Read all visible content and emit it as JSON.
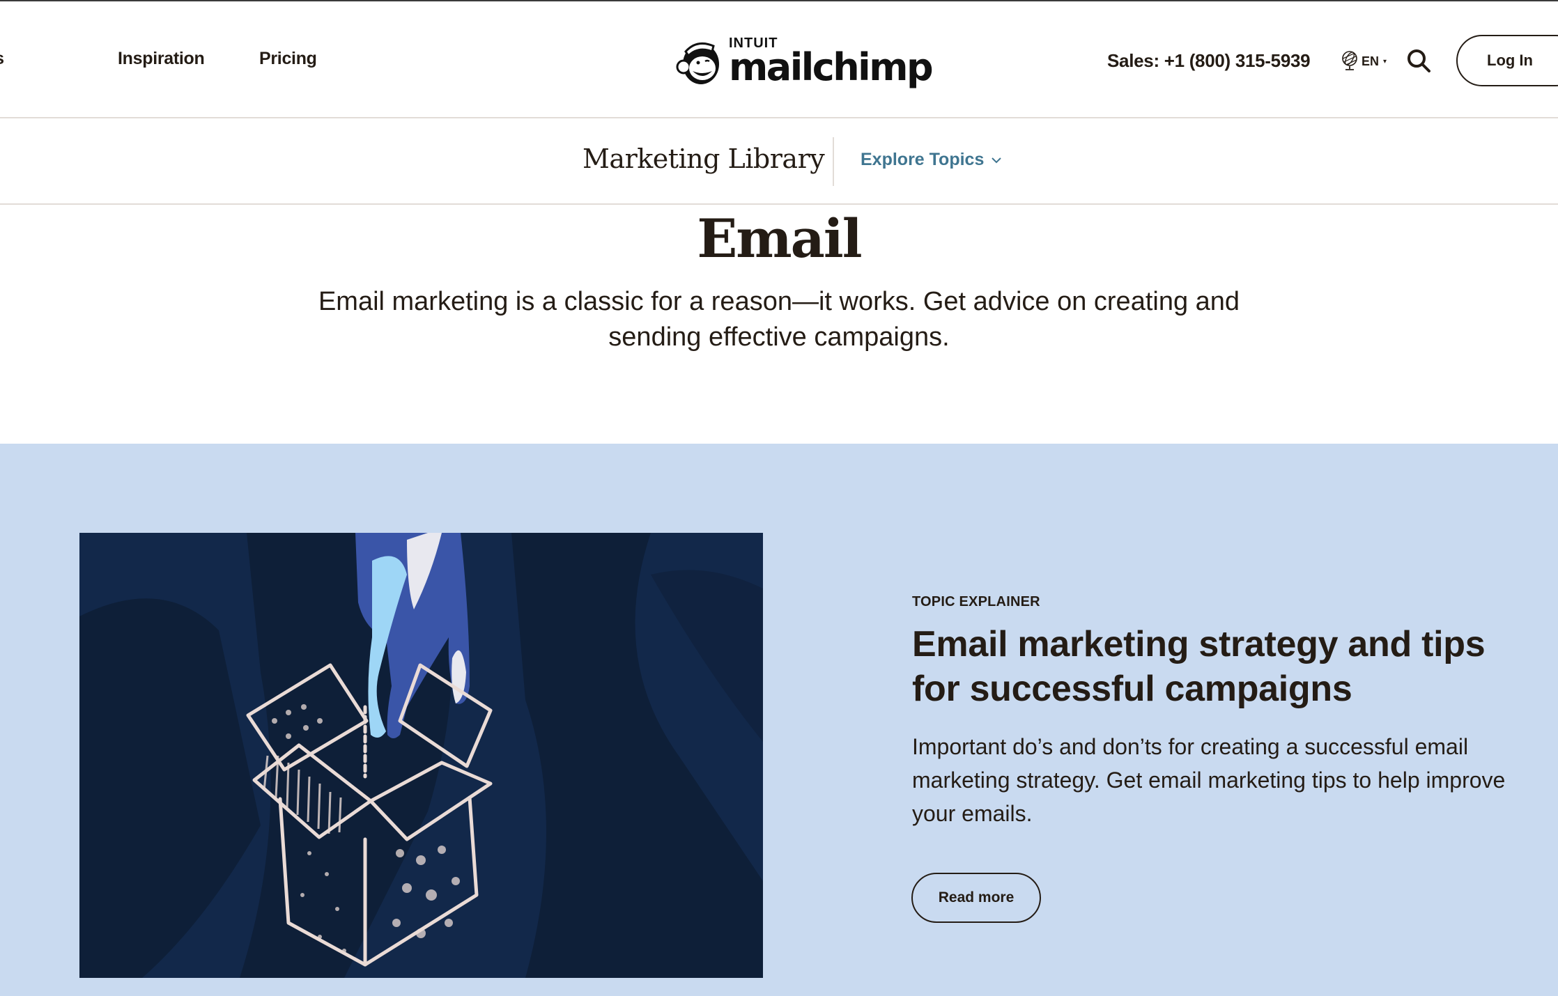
{
  "header": {
    "nav_links": [
      {
        "label": "Resources",
        "visible_label": "sources"
      },
      {
        "label": "Inspiration"
      },
      {
        "label": "Pricing"
      }
    ],
    "logo": {
      "intuit": "INTUIT",
      "brand": "mailchimp",
      "icon": "freddie-monkey-icon"
    },
    "sales_phone": "Sales: +1 (800) 315-5939",
    "language": {
      "label": "EN",
      "icon": "globe-icon"
    },
    "search_icon": "search-icon",
    "login_label": "Log In"
  },
  "sub_header": {
    "title": "Marketing Library",
    "explore_label": "Explore Topics",
    "explore_icon": "chevron-down-icon"
  },
  "hero": {
    "title": "Email",
    "description": "Email marketing is a classic for a reason—it works. Get advice on creating and sending effective campaigns."
  },
  "feature": {
    "image_alt": "Hand reaching into an open chalk-drawn box",
    "eyebrow": "TOPIC EXPLAINER",
    "title": "Email marketing strategy and tips for successful campaigns",
    "description": "Important do’s and don’ts for creating a successful email marketing strategy. Get email marketing tips to help improve your emails.",
    "cta_label": "Read more"
  },
  "colors": {
    "text": "#241c15",
    "accent_link": "#3f7590",
    "feature_bg": "#c9daf0",
    "image_bg": "#12284a",
    "divider": "#e2dcd7"
  }
}
